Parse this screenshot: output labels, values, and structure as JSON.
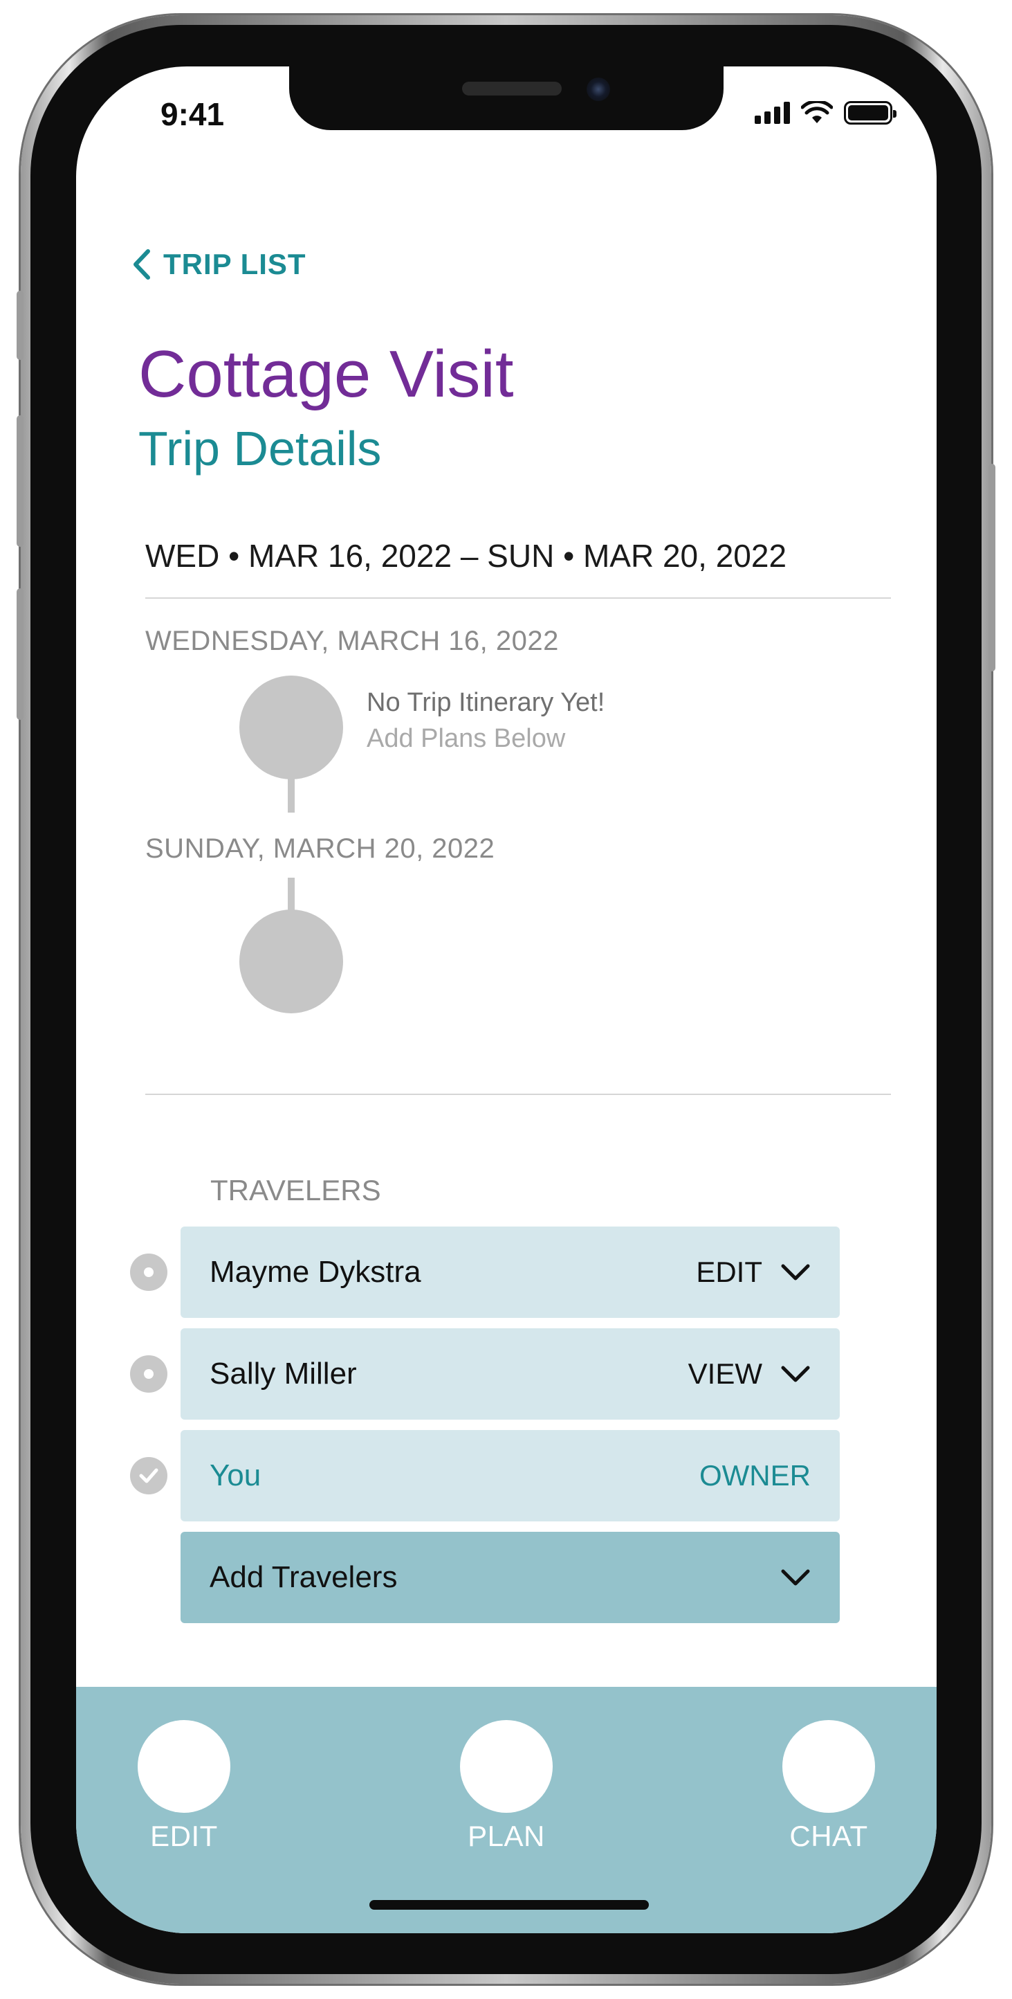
{
  "status_bar": {
    "time": "9:41",
    "icons": [
      "cellular-signal-icon",
      "wifi-icon",
      "battery-icon"
    ]
  },
  "nav": {
    "back_label": "TRIP LIST",
    "back_icon": "chevron-left-icon"
  },
  "header": {
    "title": "Cottage Visit",
    "subtitle": "Trip Details"
  },
  "trip": {
    "date_range": "WED • MAR 16, 2022 – SUN • MAR 20, 2022",
    "days": [
      {
        "label": "WEDNESDAY, MARCH 16, 2022"
      },
      {
        "label": "SUNDAY, MARCH 20, 2022"
      }
    ],
    "itinerary_empty": {
      "primary": "No Trip Itinerary Yet!",
      "secondary": "Add Plans Below"
    }
  },
  "travelers": {
    "label": "TRAVELERS",
    "rows": [
      {
        "name": "Mayme Dykstra",
        "role": "EDIT",
        "indicator": "radio-dot-icon"
      },
      {
        "name": "Sally Miller",
        "role": "VIEW",
        "indicator": "radio-dot-icon"
      },
      {
        "name": "You",
        "role": "OWNER",
        "indicator": "checkmark-circle-icon"
      }
    ],
    "add_label": "Add Travelers"
  },
  "tabbar": {
    "tabs": [
      {
        "label": "EDIT"
      },
      {
        "label": "PLAN"
      },
      {
        "label": "CHAT"
      }
    ]
  },
  "colors": {
    "accent_purple": "#722c97",
    "accent_teal": "#1b8b93",
    "row_bg": "#d5e7ec",
    "tabbar_bg": "#94c2cb",
    "node_gray": "#c6c6c6"
  }
}
